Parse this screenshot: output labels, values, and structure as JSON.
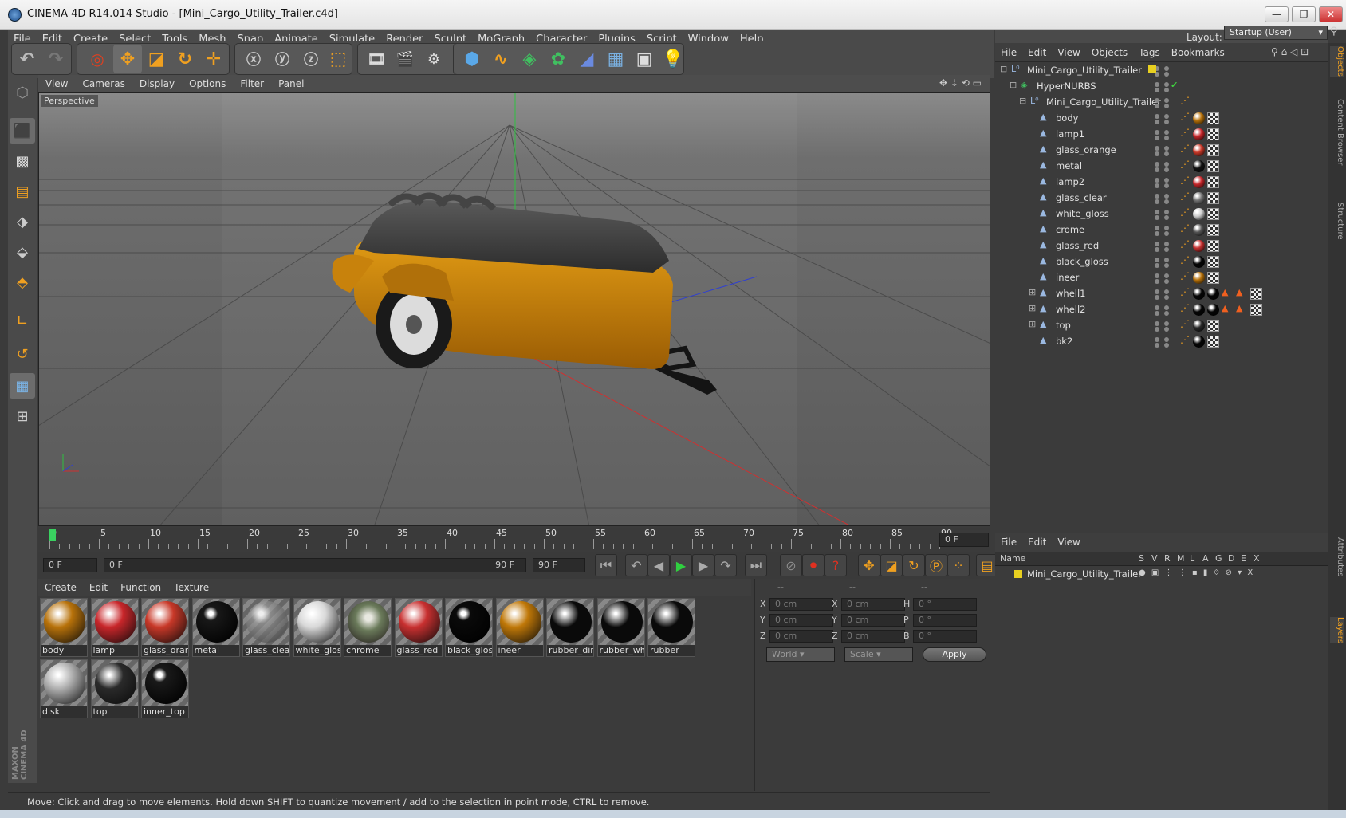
{
  "window": {
    "title": "CINEMA 4D R14.014 Studio - [Mini_Cargo_Utility_Trailer.c4d]",
    "minimize": "—",
    "maximize": "❐",
    "close": "✕"
  },
  "menu": [
    "File",
    "Edit",
    "Create",
    "Select",
    "Tools",
    "Mesh",
    "Snap",
    "Animate",
    "Simulate",
    "Render",
    "Sculpt",
    "MoGraph",
    "Character",
    "Plugins",
    "Script",
    "Window",
    "Help"
  ],
  "layout": {
    "label": "Layout:",
    "value": "Startup (User)"
  },
  "viewport": {
    "menu": [
      "View",
      "Cameras",
      "Display",
      "Options",
      "Filter",
      "Panel"
    ],
    "label": "Perspective"
  },
  "timeline": {
    "ticks": [
      "0",
      "5",
      "10",
      "15",
      "20",
      "25",
      "30",
      "35",
      "40",
      "45",
      "50",
      "55",
      "60",
      "65",
      "70",
      "75",
      "80",
      "85",
      "90"
    ],
    "current": "0 F"
  },
  "transport": {
    "start": "0 F",
    "range_start": "0 F",
    "range_end": "90 F",
    "end": "90 F"
  },
  "materials": {
    "menu": [
      "Create",
      "Edit",
      "Function",
      "Texture"
    ],
    "items": [
      {
        "name": "body",
        "color": "#b8720a",
        "style": "solid"
      },
      {
        "name": "lamp",
        "color": "#c8262a",
        "style": "solid"
      },
      {
        "name": "glass_oran",
        "color": "#c83828",
        "style": "solid"
      },
      {
        "name": "metal",
        "color": "#181818",
        "style": "shiny"
      },
      {
        "name": "glass_clear",
        "color": "#888888",
        "style": "clear"
      },
      {
        "name": "white_glos",
        "color": "#d8d8d8",
        "style": "solid"
      },
      {
        "name": "chrome",
        "color": "#8a8a7a",
        "style": "chrome"
      },
      {
        "name": "glass_red",
        "color": "#c83030",
        "style": "solid"
      },
      {
        "name": "black_glos",
        "color": "#0a0a0a",
        "style": "shiny"
      },
      {
        "name": "ineer",
        "color": "#c07808",
        "style": "solid"
      },
      {
        "name": "rubber_dir",
        "color": "#0a0a0a",
        "style": "solid"
      },
      {
        "name": "rubber_wh",
        "color": "#0a0a0a",
        "style": "solid"
      },
      {
        "name": "rubber",
        "color": "#0a0a0a",
        "style": "solid"
      },
      {
        "name": "disk",
        "color": "#b0b0b0",
        "style": "solid"
      },
      {
        "name": "top",
        "color": "#2a2a2a",
        "style": "solid"
      },
      {
        "name": "inner_top",
        "color": "#1a1a1a",
        "style": "shiny"
      }
    ]
  },
  "coordinates": {
    "headers": [
      "--",
      "--",
      "--"
    ],
    "rows": [
      {
        "a": "X",
        "av": "0 cm",
        "b": "X",
        "bv": "0 cm",
        "c": "H",
        "cv": "0 °"
      },
      {
        "a": "Y",
        "av": "0 cm",
        "b": "Y",
        "bv": "0 cm",
        "c": "P",
        "cv": "0 °"
      },
      {
        "a": "Z",
        "av": "0 cm",
        "b": "Z",
        "bv": "0 cm",
        "c": "B",
        "cv": "0 °"
      }
    ],
    "mode": "World",
    "scale": "Scale",
    "apply": "Apply"
  },
  "objects": {
    "menu": [
      "File",
      "Edit",
      "View",
      "Objects",
      "Tags",
      "Bookmarks"
    ],
    "items": [
      {
        "name": "Mini_Cargo_Utility_Trailer",
        "indent": 0,
        "type": "null",
        "expand": "−",
        "tags": []
      },
      {
        "name": "HyperNURBS",
        "indent": 1,
        "type": "nurbs",
        "expand": "−",
        "tags": []
      },
      {
        "name": "Mini_Cargo_Utility_Trailer",
        "indent": 2,
        "type": "null",
        "expand": "−",
        "tags": []
      },
      {
        "name": "body",
        "indent": 3,
        "type": "poly",
        "expand": "",
        "tags": [
          "#b8720a"
        ]
      },
      {
        "name": "lamp1",
        "indent": 3,
        "type": "poly",
        "expand": "",
        "tags": [
          "#c8262a"
        ]
      },
      {
        "name": "glass_orange",
        "indent": 3,
        "type": "poly",
        "expand": "",
        "tags": [
          "#c83828"
        ]
      },
      {
        "name": "metal",
        "indent": 3,
        "type": "poly",
        "expand": "",
        "tags": [
          "#111111"
        ]
      },
      {
        "name": "lamp2",
        "indent": 3,
        "type": "poly",
        "expand": "",
        "tags": [
          "#c8262a"
        ]
      },
      {
        "name": "glass_clear",
        "indent": 3,
        "type": "poly",
        "expand": "",
        "tags": [
          "#777777"
        ]
      },
      {
        "name": "white_gloss",
        "indent": 3,
        "type": "poly",
        "expand": "",
        "tags": [
          "#cfcfcf"
        ]
      },
      {
        "name": "crome",
        "indent": 3,
        "type": "poly",
        "expand": "",
        "tags": [
          "#555555"
        ]
      },
      {
        "name": "glass_red",
        "indent": 3,
        "type": "poly",
        "expand": "",
        "tags": [
          "#c83030"
        ]
      },
      {
        "name": "black_gloss",
        "indent": 3,
        "type": "poly",
        "expand": "",
        "tags": [
          "#050505"
        ]
      },
      {
        "name": "ineer",
        "indent": 3,
        "type": "poly",
        "expand": "",
        "tags": [
          "#b8720a"
        ]
      },
      {
        "name": "whell1",
        "indent": 3,
        "type": "poly",
        "expand": "+",
        "tags": [
          "#050505",
          "#050505"
        ]
      },
      {
        "name": "whell2",
        "indent": 3,
        "type": "poly",
        "expand": "+",
        "tags": [
          "#050505",
          "#050505"
        ]
      },
      {
        "name": "top",
        "indent": 3,
        "type": "poly",
        "expand": "+",
        "tags": [
          "#2a2a2a"
        ]
      },
      {
        "name": "bk2",
        "indent": 3,
        "type": "poly",
        "expand": "",
        "tags": [
          "#050505"
        ]
      }
    ]
  },
  "layers": {
    "menu": [
      "File",
      "Edit",
      "View"
    ],
    "columns": [
      "Name",
      "S",
      "V",
      "R",
      "M",
      "L",
      "A",
      "G",
      "D",
      "E",
      "X"
    ],
    "items": [
      {
        "name": "Mini_Cargo_Utility_Trailer",
        "color": "#e8d020"
      }
    ]
  },
  "right_tabs": [
    "Objects",
    "Content Browser",
    "Structure",
    "Attributes",
    "Layers"
  ],
  "brand": {
    "line1": "MAXON",
    "line2": "CINEMA 4D"
  },
  "status": "Move: Click and drag to move elements. Hold down SHIFT to quantize movement / add to the selection in point mode, CTRL to remove."
}
